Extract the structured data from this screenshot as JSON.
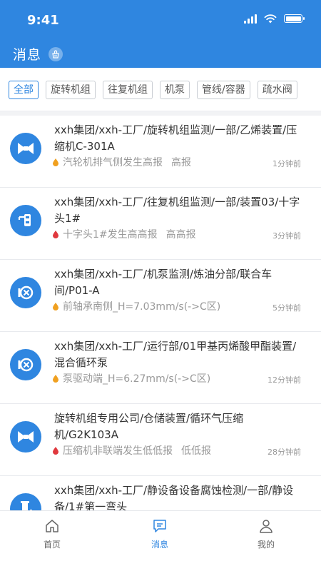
{
  "status": {
    "time": "9:41"
  },
  "header": {
    "title": "消息"
  },
  "filters": [
    "全部",
    "旋转机组",
    "往复机组",
    "机泵",
    "管线/容器",
    "疏水阀"
  ],
  "messages": [
    {
      "icon": "compressor-icon",
      "path": "xxh集团/xxh-工厂/旋转机组监测/一部/乙烯装置/压缩机C-301A",
      "alert": "汽轮机排气侧发生高报",
      "level": "高报",
      "time": "1分钟前",
      "severity_color": "#f0a020"
    },
    {
      "icon": "crosshead-icon",
      "path": "xxh集团/xxh-工厂/往复机组监测/一部/装置03/十字头1#",
      "alert": "十字头1#发生高高报",
      "level": "高高报",
      "time": "3分钟前",
      "severity_color": "#e0393e"
    },
    {
      "icon": "pump-icon",
      "path": "xxh集团/xxh-工厂/机泵监测/炼油分部/联合车间/P01-A",
      "alert": "前轴承南侧_H=7.03mm/s(->C区)",
      "level": "",
      "time": "5分钟前",
      "severity_color": "#f0a020"
    },
    {
      "icon": "pump-icon",
      "path": "xxh集团/xxh-工厂/运行部/01甲基丙烯酸甲酯装置/混合循环泵",
      "alert": "泵驱动端_H=6.27mm/s(->C区)",
      "level": "",
      "time": "12分钟前",
      "severity_color": "#f0a020"
    },
    {
      "icon": "compressor-icon",
      "path": "旋转机组专用公司/仓储装置/循环气压缩机/G2K103A",
      "alert": "压缩机非联端发生低低报",
      "level": "低低报",
      "time": "28分钟前",
      "severity_color": "#e0393e"
    },
    {
      "icon": "pipe-icon",
      "path": "xxh集团/xxh-工厂/静设备设备腐蚀检测/一部/静设备/1#第一弯头",
      "alert": "",
      "level": "",
      "time": "",
      "severity_color": ""
    }
  ],
  "tabs": [
    {
      "label": "首页",
      "icon": "home-icon"
    },
    {
      "label": "消息",
      "icon": "message-icon"
    },
    {
      "label": "我的",
      "icon": "profile-icon"
    }
  ],
  "colors": {
    "primary": "#2f86e0",
    "warning": "#f0a020",
    "danger": "#e0393e"
  }
}
